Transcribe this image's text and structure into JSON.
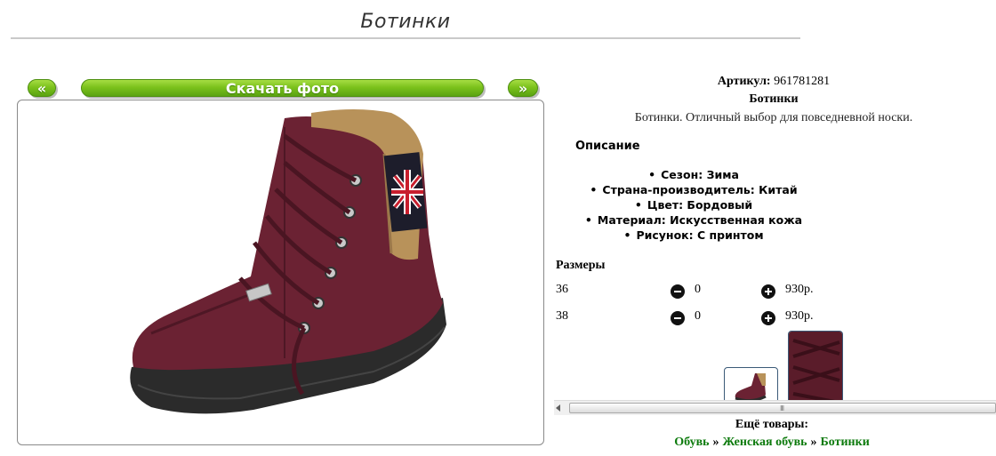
{
  "page": {
    "title": "Ботинки"
  },
  "gallery": {
    "prev_label": "«",
    "download_label": "Скачать фото",
    "next_label": "»"
  },
  "product": {
    "article_label": "Артикул:",
    "article_value": "961781281",
    "name": "Ботинки",
    "description": "Ботинки. Отличный выбор для повседневной носки."
  },
  "description_section": {
    "heading": "Описание",
    "attributes": [
      "Сезон: Зима",
      "Страна-производитель: Китай",
      "Цвет: Бордовый",
      "Материал: Искусственная кожа",
      "Рисунок: С принтом"
    ]
  },
  "sizes": {
    "heading": "Размеры",
    "rows": [
      {
        "size": "36",
        "qty": "0",
        "price": "930р."
      },
      {
        "size": "38",
        "qty": "0",
        "price": "930р."
      }
    ],
    "minus_icon": "minus-circle-icon",
    "plus_icon": "plus-circle-icon"
  },
  "thumbnails": [
    "boot-photo-thumbnail",
    "laces-closeup-thumbnail"
  ],
  "more": {
    "label": "Ещё товары:",
    "breadcrumb": [
      "Обувь",
      "Женская обувь",
      "Ботинки"
    ],
    "separator": "»"
  },
  "colors": {
    "button_green": "#7cc21c",
    "link_green": "#0c7a0c",
    "boot_burgundy": "#6b2233",
    "fur": "#b8925a"
  }
}
